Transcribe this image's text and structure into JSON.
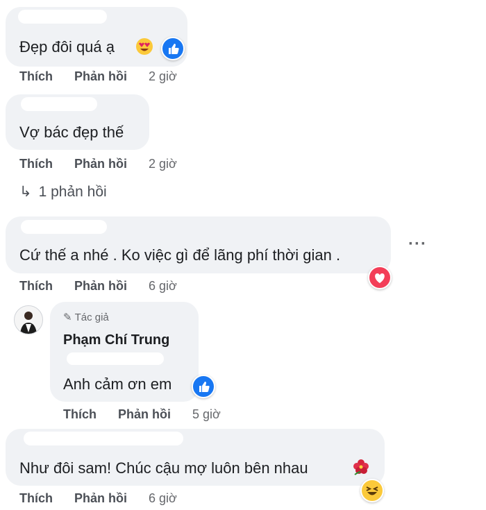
{
  "comments": [
    {
      "text": "Đẹp đôi quá ạ",
      "like": "Thích",
      "reply": "Phản hồi",
      "time": "2 giờ"
    },
    {
      "text": "Vợ bác đẹp thế",
      "like": "Thích",
      "reply": "Phản hồi",
      "time": "2 giờ",
      "replies_link": "1 phản hồi"
    },
    {
      "text": "Cứ thế a nhé . Ko việc gì để lãng phí thời gian .",
      "like": "Thích",
      "reply": "Phản hồi",
      "time": "6 giờ",
      "more": "···"
    },
    {
      "text": "Như đôi sam! Chúc cậu mợ luôn bên nhau",
      "like": "Thích",
      "reply": "Phản hồi",
      "time": "6 giờ"
    }
  ],
  "reply": {
    "badge": "Tác giả",
    "author": "Phạm Chí Trung",
    "text": "Anh cảm ơn em",
    "like": "Thích",
    "reply": "Phản hồi",
    "time": "5 giờ"
  },
  "colors": {
    "bubble": "#f0f2f5",
    "like_blue": "#1877f2",
    "heart_red": "#f33e58",
    "haha_yellow": "#fbc93a"
  }
}
